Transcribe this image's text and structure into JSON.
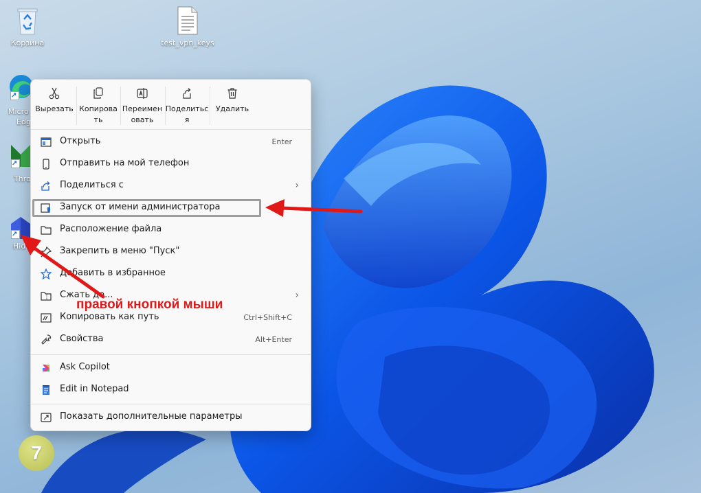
{
  "desktop": {
    "recycle_bin": "Корзина",
    "file_icon": "test_vpn_keys",
    "edge_partial_1": "Micro",
    "edge_partial_2": "Edg",
    "thr_partial": "Thro",
    "hid_partial": "Hid"
  },
  "quick_actions": [
    {
      "label_1": "Вырезать",
      "label_2": "",
      "icon": "scissors-icon"
    },
    {
      "label_1": "Копирова",
      "label_2": "ть",
      "icon": "copy-icon"
    },
    {
      "label_1": "Переимен",
      "label_2": "овать",
      "icon": "rename-icon"
    },
    {
      "label_1": "Поделитьс",
      "label_2": "я",
      "icon": "share-icon"
    },
    {
      "label_1": "Удалить",
      "label_2": "",
      "icon": "trash-icon"
    }
  ],
  "items": [
    {
      "label": "Открыть",
      "shortcut": "Enter"
    },
    {
      "label": "Отправить на мой телефон",
      "shortcut": ""
    },
    {
      "label": "Поделиться с",
      "shortcut": ""
    },
    {
      "label": "Запуск от имени администратора",
      "shortcut": ""
    },
    {
      "label": "Расположение файла",
      "shortcut": ""
    },
    {
      "label": "Закрепить в меню \"Пуск\"",
      "shortcut": ""
    },
    {
      "label": "Добавить в избранное",
      "shortcut": ""
    },
    {
      "label": "Сжать до...",
      "shortcut": ""
    },
    {
      "label": "Копировать как путь",
      "shortcut": "Ctrl+Shift+C"
    },
    {
      "label": "Свойства",
      "shortcut": "Alt+Enter"
    },
    {
      "label": "Ask Copilot",
      "shortcut": ""
    },
    {
      "label": "Edit in Notepad",
      "shortcut": ""
    },
    {
      "label": "Показать дополнительные параметры",
      "shortcut": ""
    }
  ],
  "annotation": "правой кнопкой мыши",
  "step_badge": "7",
  "colors": {
    "accent": "#1b67d6",
    "arrow": "#e01818",
    "menu_bg": "#f9f9f9"
  }
}
